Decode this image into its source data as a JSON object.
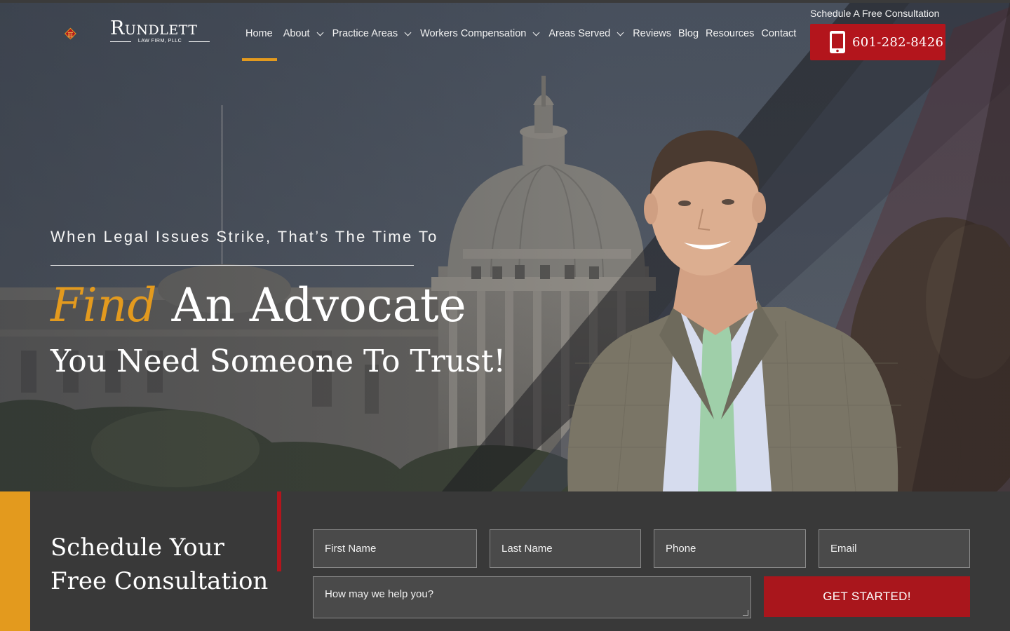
{
  "brand": {
    "name": "Rundlett",
    "subtitle": "LAW FIRM, PLLC",
    "colors": {
      "gold": "#e39a1e",
      "red": "#b3151c",
      "dark": "#393939"
    }
  },
  "nav": {
    "items": [
      {
        "label": "Home",
        "dropdown": false,
        "active": true
      },
      {
        "label": "About",
        "dropdown": true
      },
      {
        "label": "Practice Areas",
        "dropdown": true
      },
      {
        "label": "Workers Compensation",
        "dropdown": true
      },
      {
        "label": "Areas Served",
        "dropdown": true
      },
      {
        "label": "Reviews",
        "dropdown": false
      },
      {
        "label": "Blog",
        "dropdown": false
      },
      {
        "label": "Resources",
        "dropdown": false
      },
      {
        "label": "Contact",
        "dropdown": false
      }
    ]
  },
  "header_cta": {
    "schedule_text": "Schedule A Free Consultation",
    "phone": "601-282-8426",
    "phone_icon": "mobile-phone-icon"
  },
  "hero": {
    "tagline": "When Legal Issues Strike, That’s The Time To",
    "headline_accent": "Find",
    "headline_rest": " An Advocate",
    "subheadline": "You Need Someone To Trust!"
  },
  "consult": {
    "title": "Schedule Your Free Consultation",
    "fields": {
      "first_name": "First Name",
      "last_name": "Last Name",
      "phone": "Phone",
      "email": "Email",
      "message": "How may we help you?"
    },
    "submit_label": "GET STARTED!"
  }
}
